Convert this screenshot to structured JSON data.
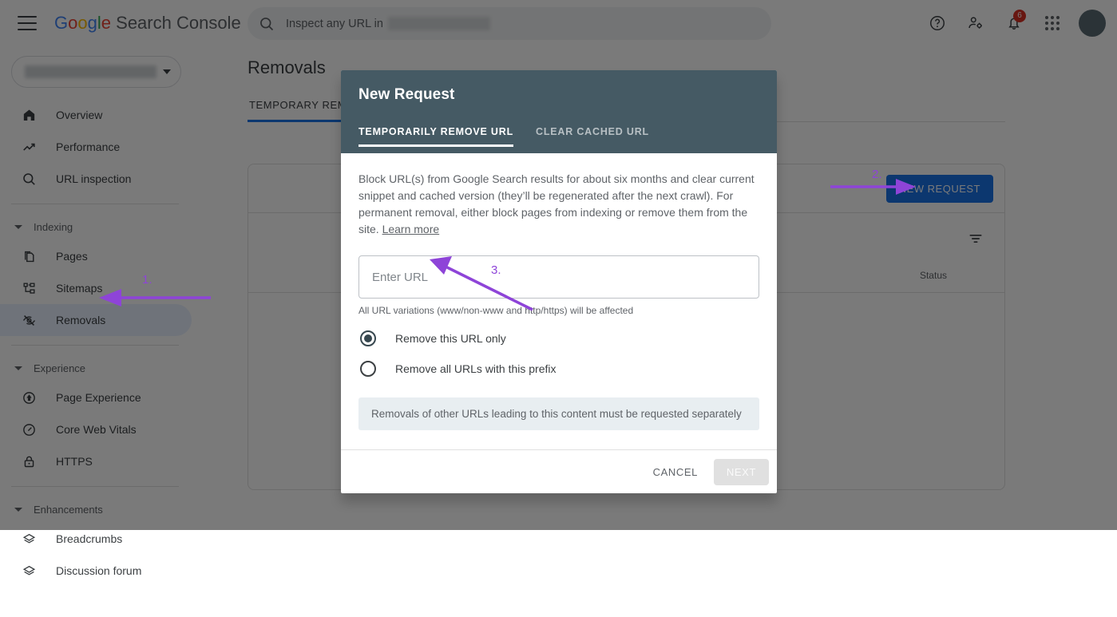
{
  "app": {
    "brand_google": "Google",
    "brand_rest": "Search Console",
    "hamburger_icon": "menu-icon"
  },
  "search": {
    "placeholder": "Inspect any URL in",
    "icon": "search-icon"
  },
  "topbar_icons": {
    "help": "help-icon",
    "account_settings": "user-settings-icon",
    "notifications": "bell-icon",
    "notifications_badge": "6",
    "apps": "apps-grid-icon",
    "avatar": "avatar"
  },
  "sidebar": {
    "property_selector_placeholder": "",
    "items": [
      {
        "label": "Overview",
        "icon": "home-icon",
        "type": "item",
        "selected": false
      },
      {
        "label": "Performance",
        "icon": "trending-up-icon",
        "type": "item",
        "selected": false
      },
      {
        "label": "URL inspection",
        "icon": "search-icon",
        "type": "item",
        "selected": false
      },
      {
        "label": "Indexing",
        "icon": "chevron-down-icon",
        "type": "group"
      },
      {
        "label": "Pages",
        "icon": "pages-icon",
        "type": "item",
        "selected": false
      },
      {
        "label": "Sitemaps",
        "icon": "sitemap-icon",
        "type": "item",
        "selected": false
      },
      {
        "label": "Removals",
        "icon": "eye-off-icon",
        "type": "item",
        "selected": true
      },
      {
        "label": "Experience",
        "icon": "chevron-down-icon",
        "type": "group"
      },
      {
        "label": "Page Experience",
        "icon": "page-experience-icon",
        "type": "item",
        "selected": false
      },
      {
        "label": "Core Web Vitals",
        "icon": "gauge-icon",
        "type": "item",
        "selected": false
      },
      {
        "label": "HTTPS",
        "icon": "lock-icon",
        "type": "item",
        "selected": false
      },
      {
        "label": "Enhancements",
        "icon": "chevron-down-icon",
        "type": "group"
      },
      {
        "label": "Breadcrumbs",
        "icon": "layers-icon",
        "type": "item",
        "selected": false
      },
      {
        "label": "Discussion forum",
        "icon": "layers-icon",
        "type": "item",
        "selected": false
      }
    ]
  },
  "main": {
    "page_title": "Removals",
    "tabs": [
      {
        "label": "TEMPORARY REMOVALS",
        "active": true
      }
    ],
    "new_request_label": "NEW REQUEST",
    "filter_icon": "filter-icon",
    "column_status": "Status"
  },
  "dialog": {
    "title": "New Request",
    "tabs": [
      {
        "label": "TEMPORARILY REMOVE URL",
        "active": true
      },
      {
        "label": "CLEAR CACHED URL",
        "active": false
      }
    ],
    "description": "Block URL(s) from Google Search results for about six months and clear current snippet and cached version (they’ll be regenerated after the next crawl). For permanent removal, either block pages from indexing or remove them from the site.",
    "learn_more": "Learn more",
    "url_placeholder": "Enter URL",
    "url_hint": "All URL variations (www/non-www and http/https) will be affected",
    "radios": [
      {
        "label": "Remove this URL only",
        "selected": true
      },
      {
        "label": "Remove all URLs with this prefix",
        "selected": false
      }
    ],
    "notice": "Removals of other URLs leading to this content must be requested separately",
    "cancel_label": "CANCEL",
    "next_label": "NEXT"
  },
  "annotations": {
    "color": "#8E44D8",
    "markers": [
      {
        "number": "1.",
        "target": "sidebar-item-removals"
      },
      {
        "number": "2.",
        "target": "new-request-button"
      },
      {
        "number": "3.",
        "target": "url-input"
      }
    ]
  },
  "colors": {
    "accent_blue": "#1a73e8",
    "dialog_header": "#455A64",
    "annotation_purple": "#8E44D8",
    "badge_red": "#d93025"
  }
}
